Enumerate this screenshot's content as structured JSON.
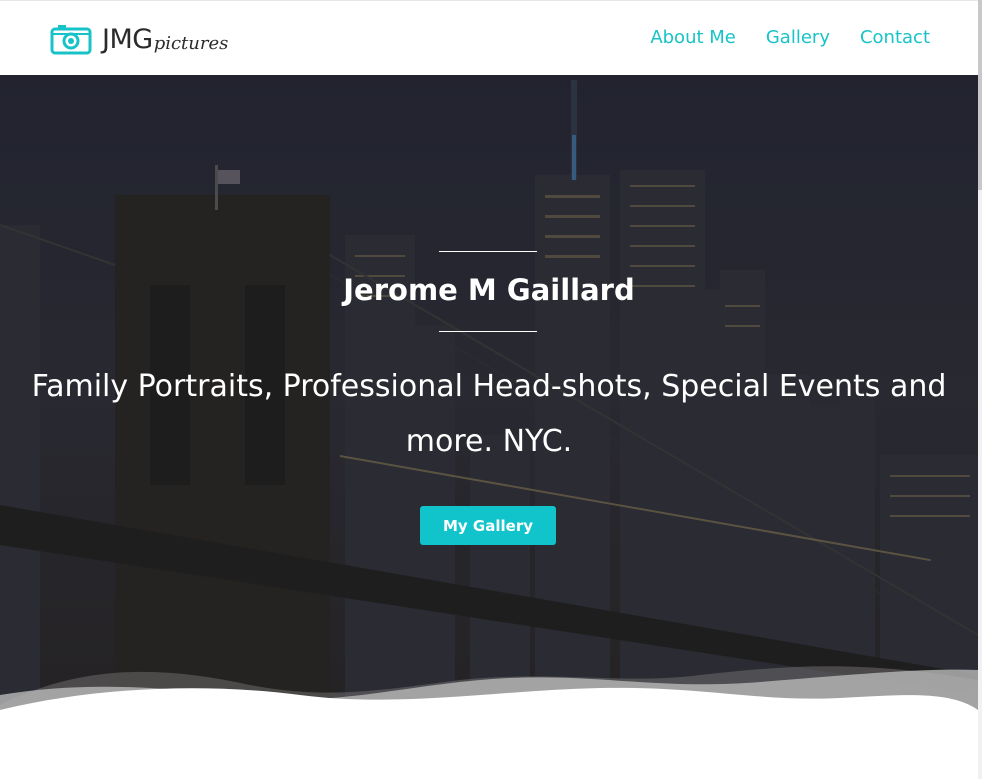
{
  "header": {
    "logo": {
      "brand": "JMG",
      "tagline": "pictures",
      "icon": "camera-icon"
    },
    "nav": [
      {
        "label": "About Me"
      },
      {
        "label": "Gallery"
      },
      {
        "label": "Contact"
      }
    ]
  },
  "hero": {
    "title": "Jerome M Gaillard",
    "subtitle": "Family Portraits, Professional Head-shots, Special Events and more. NYC.",
    "cta_label": "My Gallery"
  },
  "colors": {
    "accent": "#18c3c8",
    "button": "#11c4cc",
    "header_bg": "#ffffff",
    "hero_overlay": "#1f1f24"
  }
}
